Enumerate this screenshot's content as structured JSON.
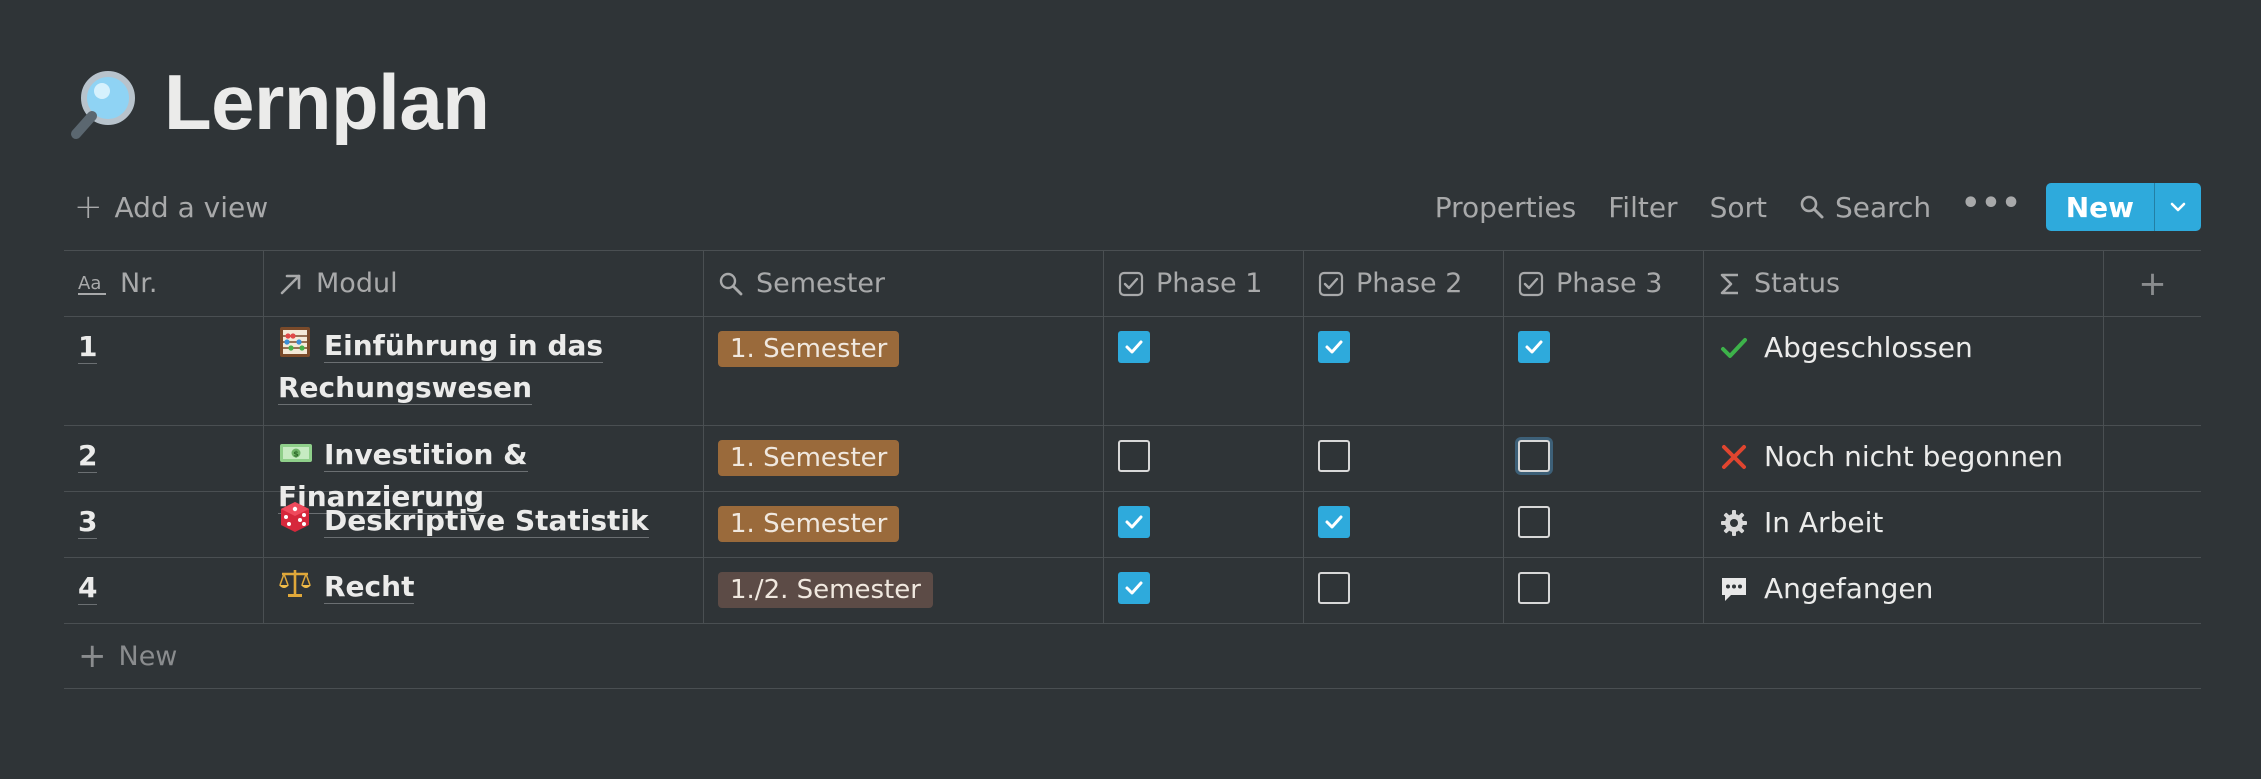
{
  "page": {
    "title": "Lernplan",
    "title_icon": "magnifier-icon"
  },
  "toolbar": {
    "add_view_label": "Add a view",
    "properties_label": "Properties",
    "filter_label": "Filter",
    "sort_label": "Sort",
    "search_label": "Search",
    "new_label": "New",
    "accent_color": "#2eaadc"
  },
  "table": {
    "columns": [
      {
        "label": "Nr.",
        "icon": "title-aa-icon"
      },
      {
        "label": "Modul",
        "icon": "relation-arrow-icon"
      },
      {
        "label": "Semester",
        "icon": "search-icon"
      },
      {
        "label": "Phase 1",
        "icon": "checkbox-icon"
      },
      {
        "label": "Phase 2",
        "icon": "checkbox-icon"
      },
      {
        "label": "Phase 3",
        "icon": "checkbox-icon"
      },
      {
        "label": "Status",
        "icon": "sigma-icon"
      }
    ],
    "rows": [
      {
        "nr": "1",
        "modul": "Einführung in das Rechungswesen",
        "modul_icon": "abacus-icon",
        "semester": "1. Semester",
        "phase1": true,
        "phase2": true,
        "phase3": true,
        "status": "Abgeschlossen",
        "status_icon": "check-mark-icon"
      },
      {
        "nr": "2",
        "modul": "Investition & Finanzierung",
        "modul_icon": "money-bill-icon",
        "semester": "1. Semester",
        "phase1": false,
        "phase2": false,
        "phase3": false,
        "status": "Noch nicht begonnen",
        "status_icon": "cross-mark-icon"
      },
      {
        "nr": "3",
        "modul": "Deskriptive Statistik",
        "modul_icon": "dice-icon",
        "semester": "1. Semester",
        "phase1": true,
        "phase2": true,
        "phase3": false,
        "status": "In Arbeit",
        "status_icon": "gear-icon"
      },
      {
        "nr": "4",
        "modul": "Recht",
        "modul_icon": "scales-icon",
        "semester": "1./2. Semester",
        "phase1": true,
        "phase2": false,
        "phase3": false,
        "status": "Angefangen",
        "status_icon": "speech-bubble-icon"
      }
    ],
    "new_row_label": "New",
    "tag_colors": {
      "1. Semester": "#9a6a3b",
      "1./2. Semester": "#5c4b46"
    }
  }
}
